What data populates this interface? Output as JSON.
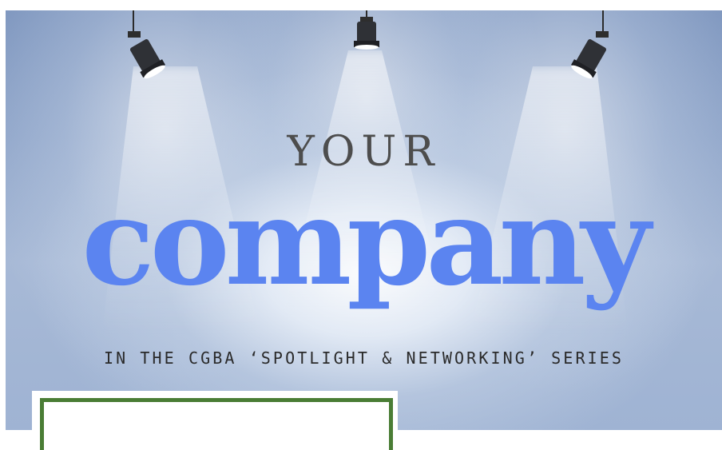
{
  "poster": {
    "line1": "YOUR",
    "line2": "company",
    "tagline": "IN THE CGBA ‘SPOTLIGHT & NETWORKING’ SERIES"
  },
  "colors": {
    "background": "#8fa5c9",
    "headline_accent": "#5b84f0",
    "headline_dark": "#4d4d4d",
    "frame_border": "#4a7d35"
  },
  "icons": [
    "spotlight-icon",
    "spotlight-icon",
    "spotlight-icon"
  ]
}
